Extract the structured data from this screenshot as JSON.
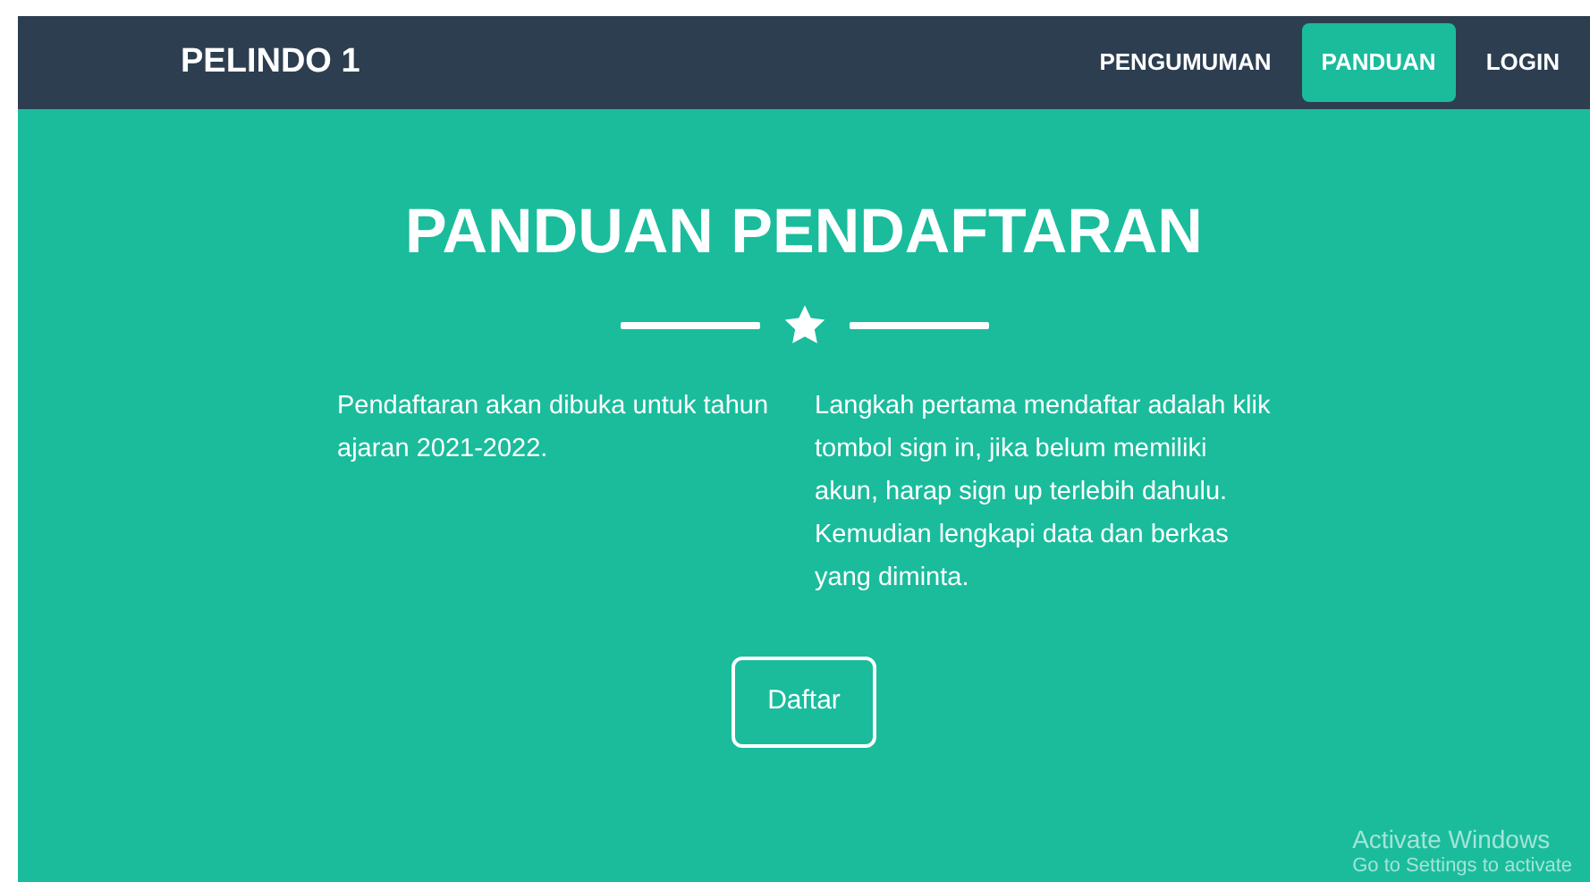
{
  "navbar": {
    "brand": "PELINDO 1",
    "links": [
      {
        "label": "PENGUMUMAN",
        "selected": false
      },
      {
        "label": "PANDUAN",
        "selected": true
      },
      {
        "label": "LOGIN",
        "selected": false
      }
    ]
  },
  "hero": {
    "title": "PANDUAN PENDAFTARAN",
    "paragraphs": [
      "Pendaftaran akan dibuka untuk tahun ajaran 2021-2022.",
      "Langkah pertama mendaftar adalah klik tombol sign in, jika belum memiliki akun, harap sign up terlebih dahulu. Kemudian lengkapi data dan berkas yang diminta."
    ],
    "button": "Daftar"
  },
  "os_notice": {
    "title": "Activate Windows",
    "subtitle": "Go to Settings to activate"
  }
}
